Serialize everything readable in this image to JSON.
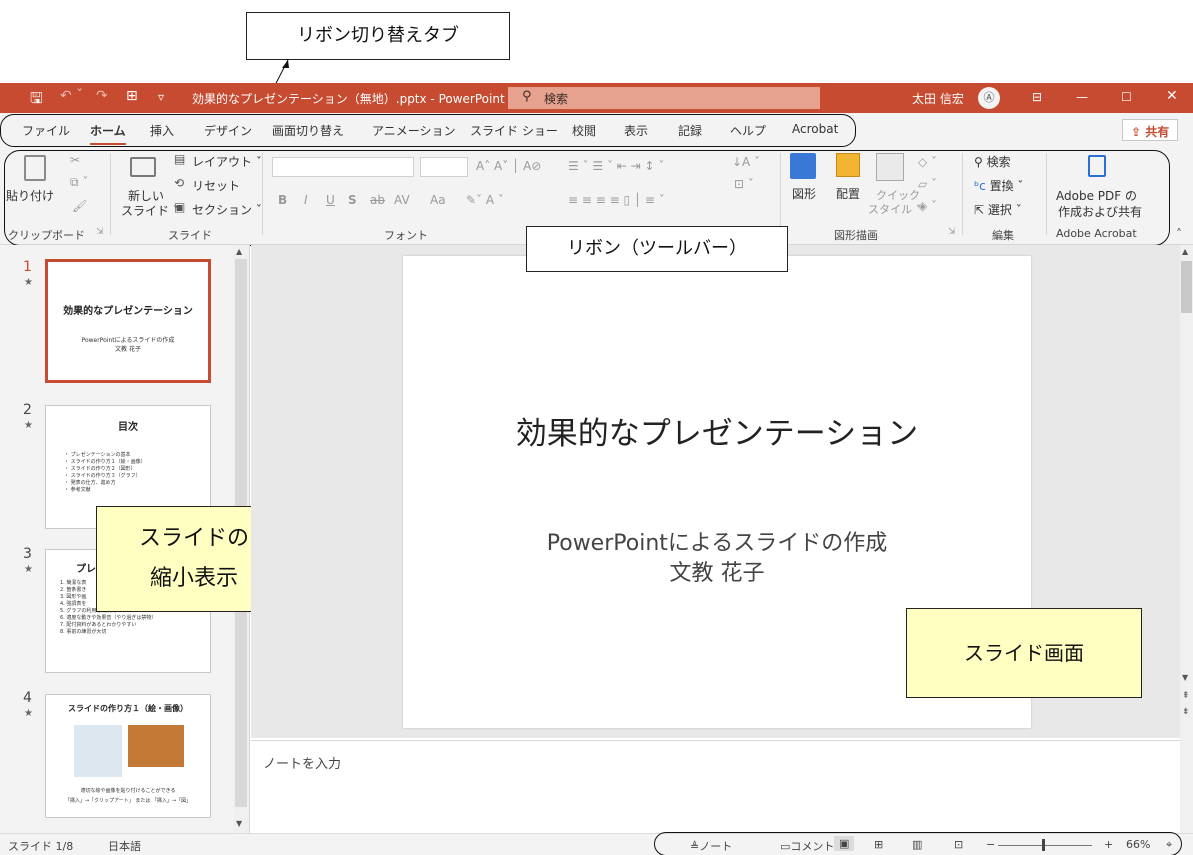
{
  "window": {
    "title": "効果的なプレゼンテーション（無地）.pptx  -  PowerPoint",
    "search_label": "検索",
    "user_name": "太田 信宏",
    "colors": {
      "accent": "#c64b30",
      "callout_fill": "#ffffc2"
    }
  },
  "tabs": [
    "ファイル",
    "ホーム",
    "挿入",
    "デザイン",
    "画面切り替え",
    "アニメーション",
    "スライド ショー",
    "校閲",
    "表示",
    "記録",
    "ヘルプ",
    "Acrobat"
  ],
  "active_tab": "ホーム",
  "share_label": "共有",
  "ribbon": {
    "clipboard": {
      "paste": "貼り付け",
      "group": "クリップボード"
    },
    "slides": {
      "new_slide": "新しい",
      "new_slide2": "スライド ˇ",
      "layout": "レイアウト ˇ",
      "reset": "リセット",
      "section": "セクション ˇ",
      "group": "スライド"
    },
    "font": {
      "group": "フォント",
      "bold": "B",
      "italic": "I",
      "underline": "U",
      "shadow": "S",
      "strike": "ab",
      "spacing": "AV",
      "case": "Aa"
    },
    "drawing": {
      "shapes": "図形",
      "arrange": "配置",
      "quick_styles": "クイック",
      "quick_styles2": "スタイル ˇ",
      "group": "図形描画"
    },
    "editing": {
      "find": "検索",
      "replace": "置換 ˇ",
      "select": "選択 ˇ",
      "group": "編集"
    },
    "acrobat": {
      "create": "Adobe PDF の",
      "create2": "作成および共有",
      "group": "Adobe Acrobat"
    }
  },
  "thumbnails": [
    {
      "num": "1",
      "title": "効果的なプレゼンテーション",
      "sub1": "PowerPointによるスライドの作成",
      "sub2": "文教  花子"
    },
    {
      "num": "2",
      "title": "目次",
      "items": [
        "・ プレゼンテーションの基本",
        "・ スライドの作り方１（絵・画像）",
        "・ スライドの作り方２（図形）",
        "・ スライドの作り方３（グラフ）",
        "・ 発表の仕方、進め方",
        "・ 参考文献"
      ]
    },
    {
      "num": "3",
      "title": "プレ",
      "items": [
        "1. 簡潔な表",
        "2. 箇条書き",
        "3. 図形や画",
        "4. 強調表を",
        "5. グラフの利用も効果的",
        "6. 適度な動きや効果音（やり過ぎは禁物）",
        "7. 配付資料があるとわかりやすい",
        "8. 事前の練習が大切"
      ]
    },
    {
      "num": "4",
      "title": "スライドの作り方１（絵・画像）",
      "caption1": "適切な絵や画像を貼り付けることができる",
      "caption2": "「挿入」→「クリップアート」 または 「挿入」→「図」"
    }
  ],
  "slide": {
    "title": "効果的なプレゼンテーション",
    "subtitle1": "PowerPointによるスライドの作成",
    "subtitle2": "文教  花子"
  },
  "notes_placeholder": "ノートを入力",
  "status": {
    "slide_pos": "スライド 1/8",
    "language": "日本語",
    "notes": "ノート",
    "comments": "コメント",
    "zoom": "66%",
    "zoom_level": 0.66
  },
  "callouts": {
    "ribbon_tabs": "リボン切り替えタブ",
    "ribbon": "リボン（ツールバー）",
    "thumbnails1": "スライドの",
    "thumbnails2": "縮小表示",
    "slide_area": "スライド画面"
  }
}
